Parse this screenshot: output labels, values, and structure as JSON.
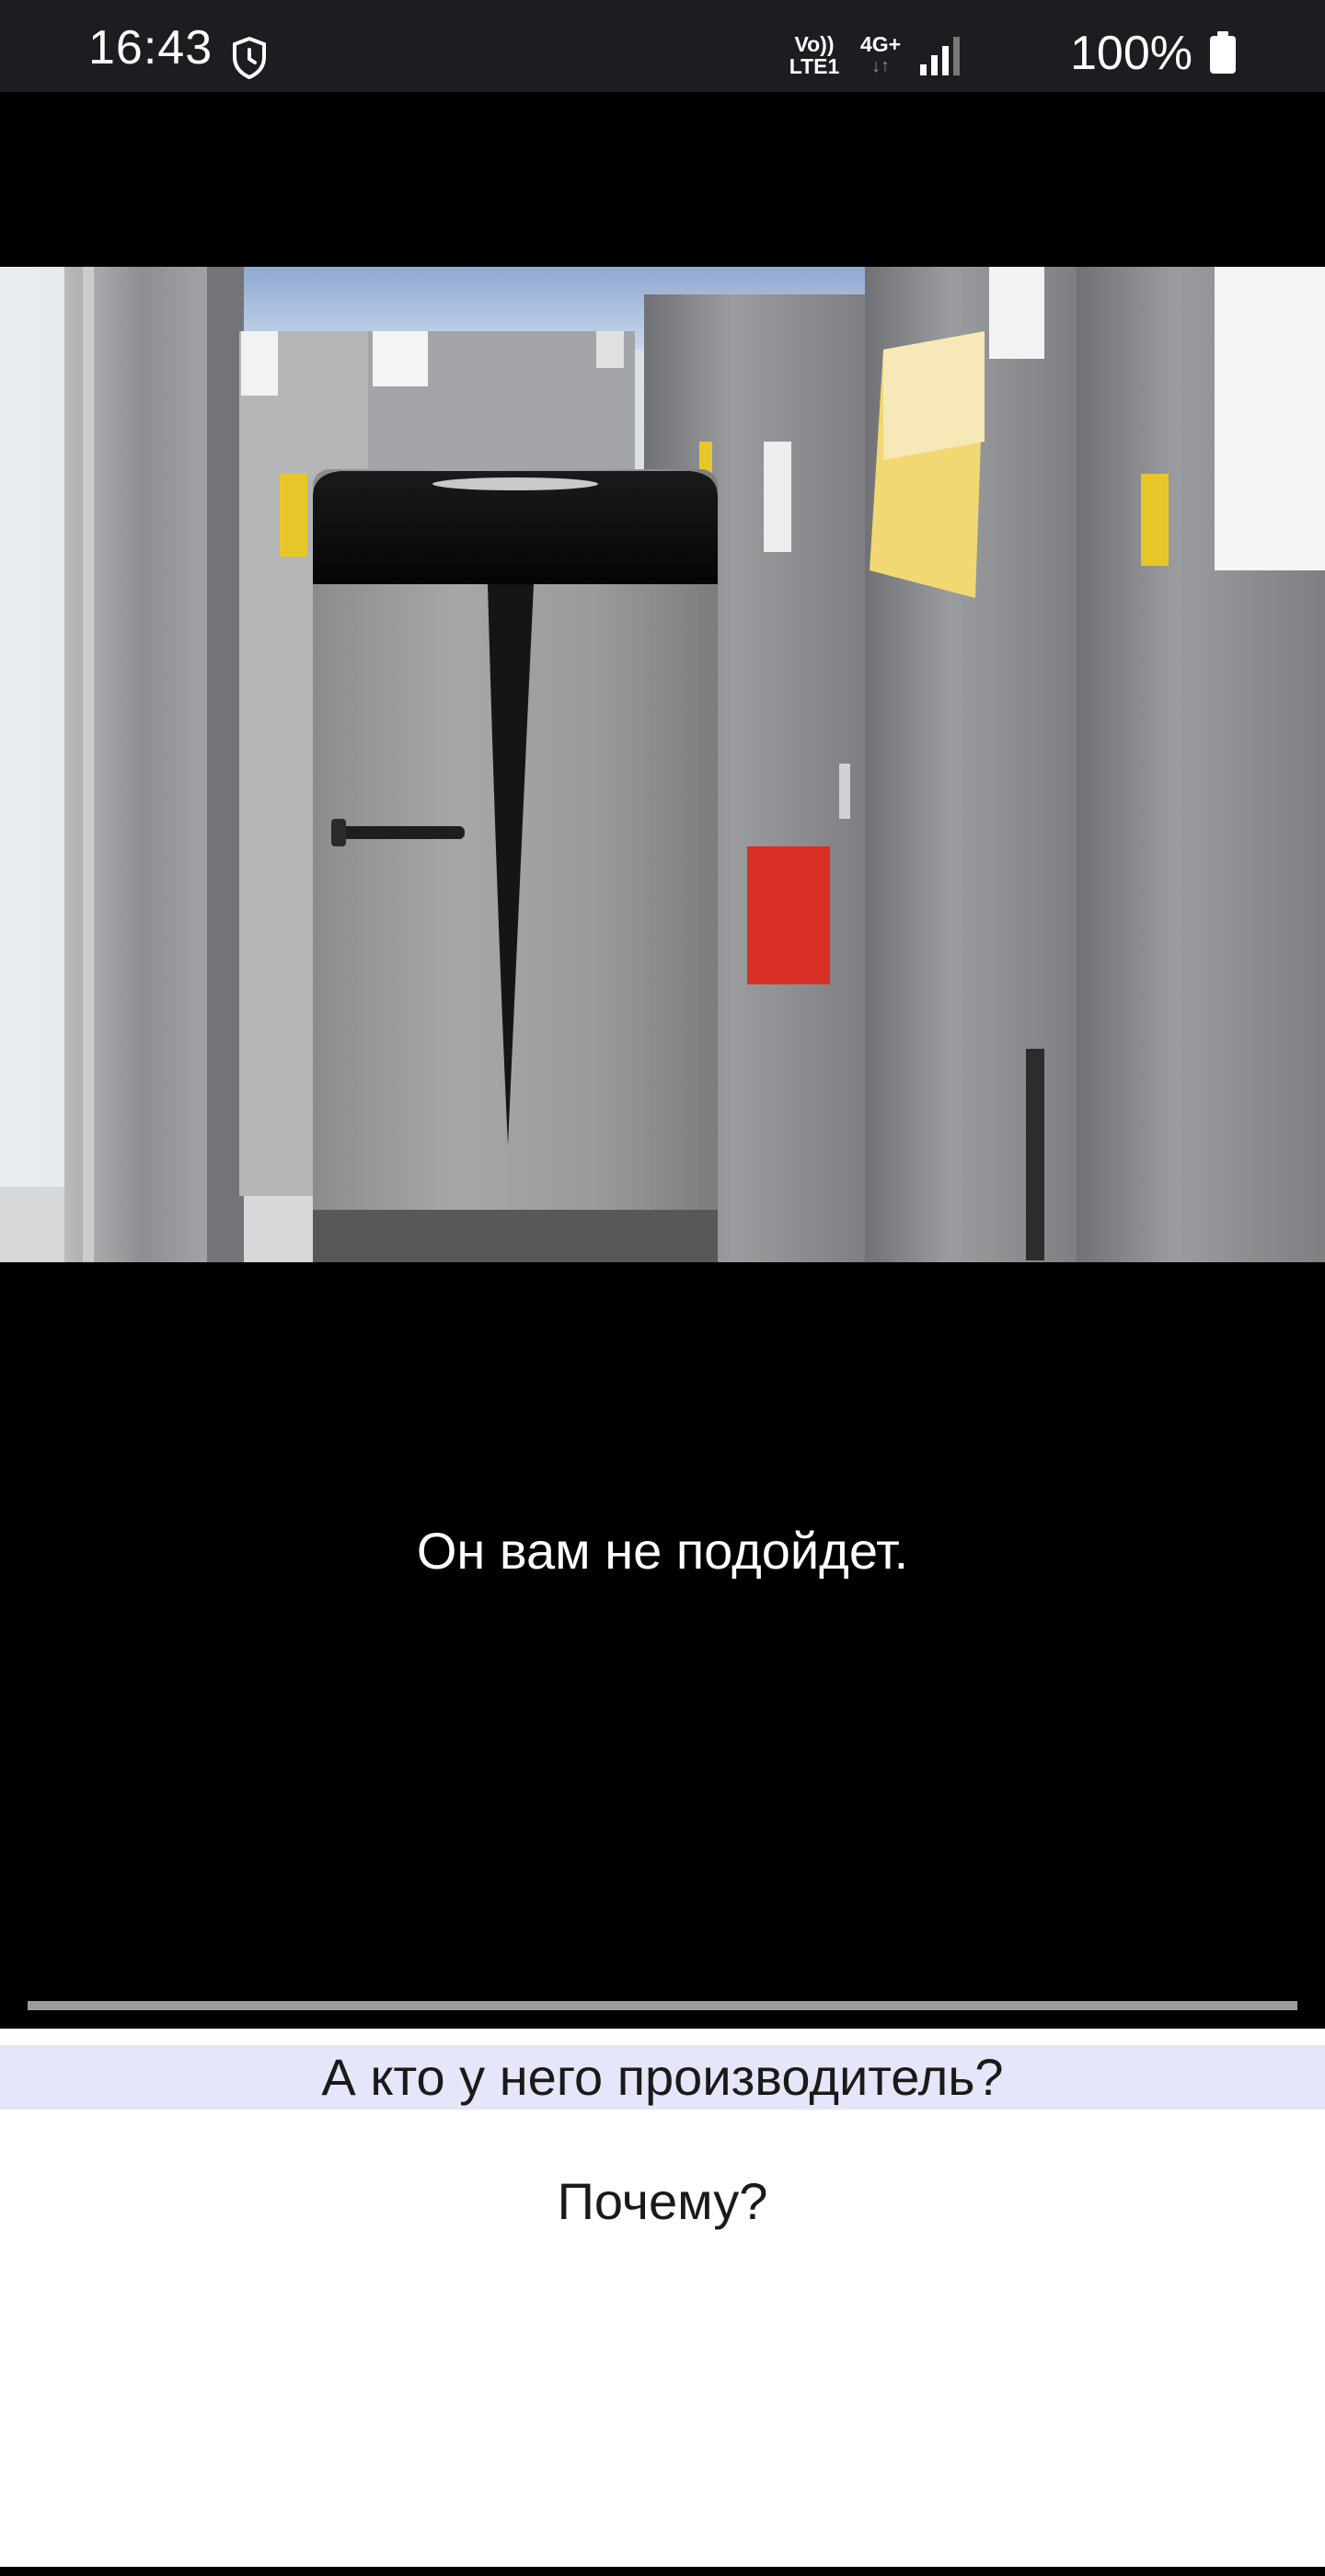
{
  "status_bar": {
    "time": "16:43",
    "volte_line1": "Vo))",
    "volte_line2": "LTE1",
    "network_type": "4G+",
    "network_arrows": "↓↑",
    "battery": "100%",
    "icons": [
      "shield-clock-icon",
      "volte-icon",
      "network-4g-icon",
      "signal-icon",
      "battery-icon"
    ]
  },
  "video": {
    "scene": "store-refrigerators",
    "subtitle": "Он вам не подойдет.",
    "progress": 1.0
  },
  "answers": [
    {
      "text": "А кто у него производитель?",
      "highlighted": true
    },
    {
      "text": "Почему?",
      "highlighted": false
    }
  ],
  "colors": {
    "status_bar_bg": "#1b1d20",
    "highlight_bg": "#e6e6fa",
    "progress_track": "#6f6f6f"
  }
}
